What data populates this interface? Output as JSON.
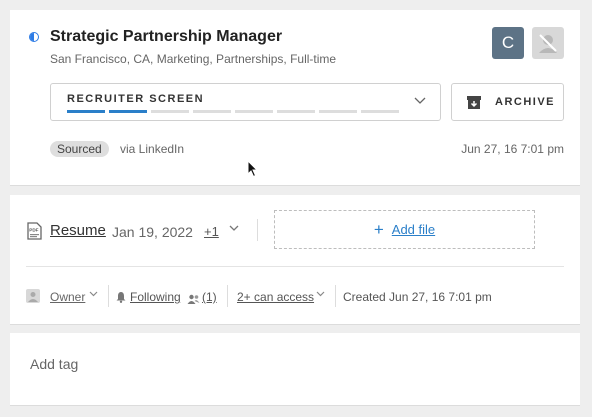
{
  "job": {
    "title": "Strategic Partnership Manager",
    "subtitle": "San Francisco, CA, Marketing, Partnerships, Full-time"
  },
  "avatar_letter": "C",
  "stage": {
    "label": "RECRUITER SCREEN",
    "segments_total": 8,
    "segments_filled": 2,
    "chevron": "chevron-down-icon"
  },
  "archive": {
    "label": "ARCHIVE",
    "icon": "archive-box-icon"
  },
  "source": {
    "badge": "Sourced",
    "via": "via LinkedIn",
    "date": "Jun 27, 16 7:01 pm"
  },
  "file": {
    "name": "Resume",
    "date": "Jan 19, 2022",
    "extra_count": "+1",
    "add_label": "Add file",
    "add_plus": "+",
    "icon_text": "PDF"
  },
  "meta": {
    "owner": "Owner",
    "following": "Following",
    "follow_count": "(1)",
    "access": "2+ can access",
    "created": "Created Jun 27, 16 7:01 pm"
  },
  "tags": {
    "placeholder": "Add tag"
  },
  "colors": {
    "accent": "#2a7fc9",
    "avatar_bg": "#5d7386",
    "page_bg": "#eeeeee"
  }
}
